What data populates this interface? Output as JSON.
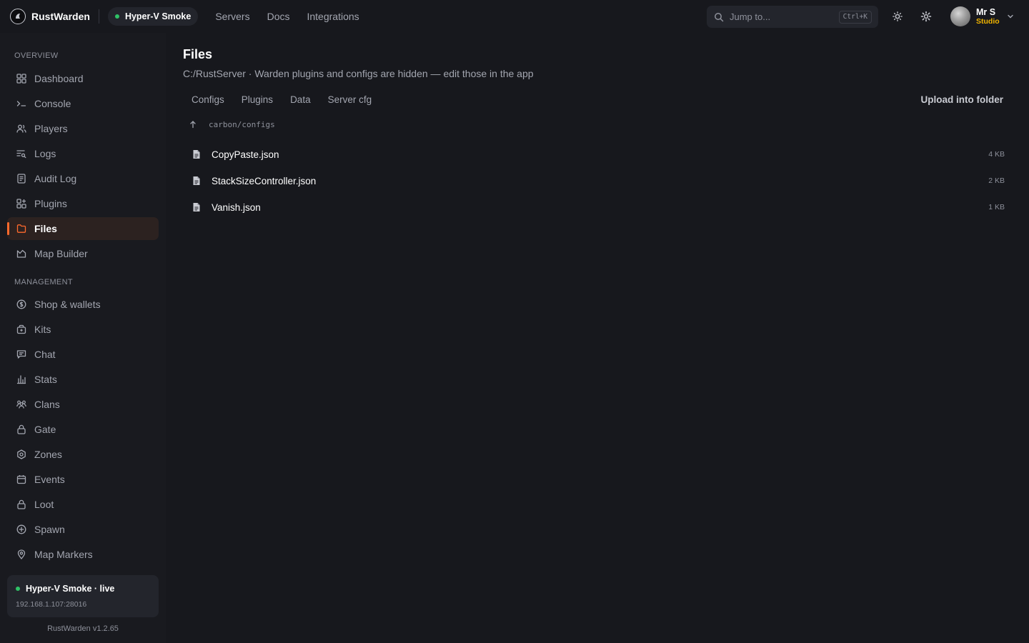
{
  "brand": {
    "name": "RustWarden"
  },
  "server_pill": {
    "label": "Hyper-V Smoke"
  },
  "topnav": [
    {
      "label": "Servers"
    },
    {
      "label": "Docs"
    },
    {
      "label": "Integrations"
    }
  ],
  "search": {
    "placeholder": "Jump to...",
    "shortcut": "Ctrl+K"
  },
  "user": {
    "name": "Mr S",
    "plan": "Studio"
  },
  "sidebar": {
    "overview_label": "OVERVIEW",
    "overview": [
      {
        "label": "Dashboard",
        "icon": "dashboard-icon"
      },
      {
        "label": "Console",
        "icon": "terminal-icon"
      },
      {
        "label": "Players",
        "icon": "users-icon"
      },
      {
        "label": "Logs",
        "icon": "logs-icon"
      },
      {
        "label": "Audit Log",
        "icon": "audit-icon"
      },
      {
        "label": "Plugins",
        "icon": "plugins-icon"
      },
      {
        "label": "Files",
        "icon": "folder-icon",
        "active": true
      },
      {
        "label": "Map Builder",
        "icon": "map-icon"
      }
    ],
    "management_label": "MANAGEMENT",
    "management": [
      {
        "label": "Shop & wallets",
        "icon": "coin-icon"
      },
      {
        "label": "Kits",
        "icon": "kit-icon"
      },
      {
        "label": "Chat",
        "icon": "chat-icon"
      },
      {
        "label": "Stats",
        "icon": "stats-icon"
      },
      {
        "label": "Clans",
        "icon": "clans-icon"
      },
      {
        "label": "Gate",
        "icon": "lock-icon"
      },
      {
        "label": "Zones",
        "icon": "zones-icon"
      },
      {
        "label": "Events",
        "icon": "calendar-icon"
      },
      {
        "label": "Loot",
        "icon": "lock-icon"
      },
      {
        "label": "Spawn",
        "icon": "plus-circle-icon"
      },
      {
        "label": "Map Markers",
        "icon": "pin-icon"
      }
    ],
    "status": {
      "title": "Hyper-V Smoke · live",
      "ip": "192.168.1.107:28016"
    },
    "version": "RustWarden v1.2.65"
  },
  "main": {
    "title": "Files",
    "subtitle": "C:/RustServer · Warden plugins and configs are hidden — edit those in the app",
    "tabs": [
      {
        "label": "Configs"
      },
      {
        "label": "Plugins"
      },
      {
        "label": "Data"
      },
      {
        "label": "Server cfg"
      }
    ],
    "upload_label": "Upload into folder",
    "path": "carbon/configs",
    "files": [
      {
        "name": "CopyPaste.json",
        "size": "4 KB"
      },
      {
        "name": "StackSizeController.json",
        "size": "2 KB"
      },
      {
        "name": "Vanish.json",
        "size": "1 KB"
      }
    ]
  },
  "colors": {
    "accent": "#ff6a2c",
    "live": "#2fc266",
    "plan": "#f0b400",
    "background": "#17181d"
  }
}
